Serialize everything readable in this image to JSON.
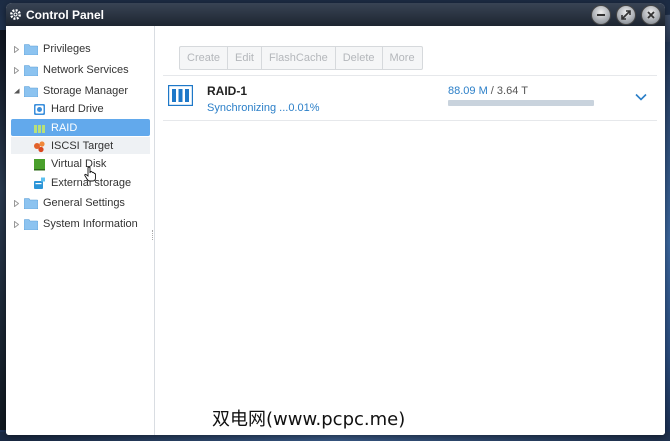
{
  "window": {
    "title": "Control Panel"
  },
  "colors": {
    "accent": "#62a9ec",
    "link": "#2b7fc8",
    "folder": "#8cc3f0"
  },
  "sidebar": {
    "items": [
      {
        "label": "Privileges",
        "icon": "folder-icon",
        "arrow": "collapsed"
      },
      {
        "label": "Network Services",
        "icon": "folder-icon",
        "arrow": "collapsed"
      },
      {
        "label": "Storage Manager",
        "icon": "folder-icon",
        "arrow": "expanded"
      },
      {
        "label": "Hard Drive",
        "icon": "hard-drive-icon"
      },
      {
        "label": "RAID",
        "icon": "raid-icon",
        "selected": true
      },
      {
        "label": "ISCSI Target",
        "icon": "iscsi-icon"
      },
      {
        "label": "Virtual Disk",
        "icon": "virtual-disk-icon"
      },
      {
        "label": "External storage",
        "icon": "external-storage-icon"
      },
      {
        "label": "General Settings",
        "icon": "folder-icon",
        "arrow": "collapsed"
      },
      {
        "label": "System Information",
        "icon": "folder-icon",
        "arrow": "collapsed"
      }
    ]
  },
  "toolbar": {
    "buttons": [
      "Create",
      "Edit",
      "FlashCache",
      "Delete",
      "More"
    ]
  },
  "raid": {
    "name": "RAID-1",
    "status": "Synchronizing ...0.01%",
    "used": "88.09 M",
    "separator": " / ",
    "total": "3.64 T",
    "usage_fraction": 0.0
  },
  "watermark": "双电网(www.pcpc.me)"
}
